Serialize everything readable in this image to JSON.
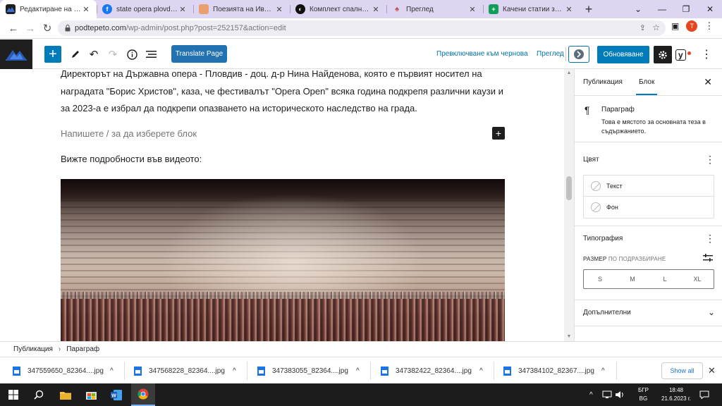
{
  "browser": {
    "tabs": [
      {
        "label": "Редактиране на публ",
        "icon": "wp-icon",
        "active": true
      },
      {
        "label": "state opera plovdiv - ",
        "icon": "facebook-icon",
        "active": false
      },
      {
        "label": "Поезията на Иван Ра",
        "icon": "page-icon",
        "active": false
      },
      {
        "label": "Комплект спално бел",
        "icon": "shop-icon",
        "active": false
      },
      {
        "label": "Преглед",
        "icon": "preview-icon",
        "active": false
      },
      {
        "label": "Качени статии за ден",
        "icon": "sheets-icon",
        "active": false
      }
    ],
    "url_domain": "podtepeto.com",
    "url_path": "/wp-admin/post.php?post=252157&action=edit",
    "profile_initial": "T"
  },
  "toolbar": {
    "translate_label": "Translate Page",
    "draft_label": "Превключване към чернова",
    "preview_label": "Преглед",
    "update_label": "Обновяване",
    "yoast_label": "y"
  },
  "editor": {
    "paragraph1": "Директорът на Държавна опера - Пловдив - доц. д-р Нина Найденова, която е първият носител на наградата \"Борис Христов\", каза, че фестивалът \"Opera Open\" всяка година подкрепя различни каузи и за 2023-а е избрал да подкрепи опазването на историческото наследство на града.",
    "placeholder": "Напишете / за да изберете блок",
    "paragraph2": "Вижте подробности във видеото:"
  },
  "sidebar": {
    "tab_post": "Публикация",
    "tab_block": "Блок",
    "block_name": "Параграф",
    "block_desc": "Това е мястото за основната теза в съдържанието.",
    "color_title": "Цвят",
    "color_text": "Текст",
    "color_bg": "Фон",
    "typography_title": "Типография",
    "size_label": "РАЗМЕР",
    "size_default": "ПО ПОДРАЗБИРАНЕ",
    "sizes": [
      "S",
      "M",
      "L",
      "XL"
    ],
    "advanced_title": "Допълнителни"
  },
  "breadcrumb": {
    "root": "Публикация",
    "current": "Параграф"
  },
  "downloads": {
    "files": [
      "347559650_82364....jpg",
      "347568228_82364....jpg",
      "347383055_82364....jpg",
      "347382422_82364....jpg",
      "347384102_82367....jpg"
    ],
    "show_all": "Show all"
  },
  "taskbar": {
    "lang_top": "БГР",
    "lang_bottom": "BG",
    "time": "18:48",
    "date": "21.6.2023 г."
  },
  "colors": {
    "wp_blue": "#007cba",
    "tab_strip": "#ded5f3",
    "taskbar": "#1c1c1c"
  }
}
